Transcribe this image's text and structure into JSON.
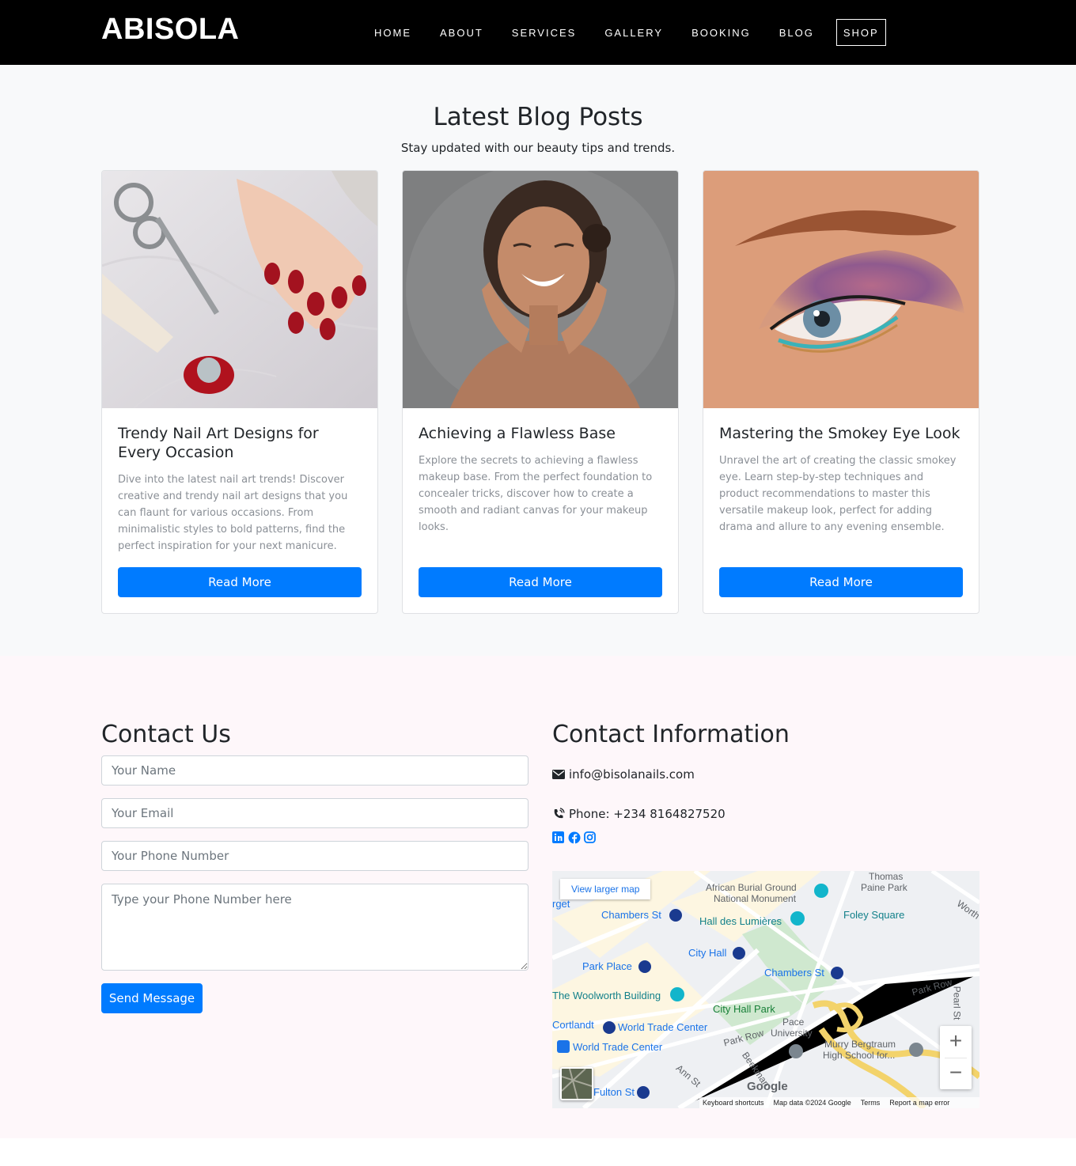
{
  "nav": {
    "brand": "ABISOLA",
    "links": [
      "HOME",
      "ABOUT",
      "SERVICES",
      "GALLERY",
      "BOOKING",
      "BLOG"
    ],
    "shop": "SHOP"
  },
  "blog": {
    "title": "Latest Blog Posts",
    "subtitle": "Stay updated with our beauty tips and trends.",
    "posts": [
      {
        "title": "Trendy Nail Art Designs for Every Occasion",
        "text": "Dive into the latest nail art trends! Discover creative and trendy nail art designs that you can flaunt for various occasions. From minimalistic styles to bold patterns, find the perfect inspiration for your next manicure.",
        "button": "Read More"
      },
      {
        "title": "Achieving a Flawless Base",
        "text": "Explore the secrets to achieving a flawless makeup base. From the perfect foundation to concealer tricks, discover how to create a smooth and radiant canvas for your makeup looks.",
        "button": "Read More"
      },
      {
        "title": "Mastering the Smokey Eye Look",
        "text": "Unravel the art of creating the classic smokey eye. Learn step-by-step techniques and product recommendations to master this versatile makeup look, perfect for adding drama and allure to any evening ensemble.",
        "button": "Read More"
      }
    ]
  },
  "contact": {
    "title": "Contact Us",
    "name_placeholder": "Your Name",
    "email_placeholder": "Your Email",
    "phone_placeholder": "Your Phone Number",
    "message_placeholder": "Type your Phone Number here",
    "send": "Send Message"
  },
  "info": {
    "title": "Contact Information",
    "email": "info@bisolanails.com",
    "phone": "Phone: +234 8164827520",
    "socials": [
      "linkedin-icon",
      "facebook-icon",
      "instagram-icon"
    ]
  },
  "map": {
    "view_larger": "View larger map",
    "labels": [
      "African Burial Ground",
      "National Monument",
      "Thomas",
      "Paine Park",
      "Worth",
      "Chambers St",
      "Hall des Lumières",
      "Foley Square",
      "City Hall",
      "Park Place",
      "Chambers St",
      "Park Row",
      "The Woolworth Building",
      "City Hall Park",
      "Pearl St",
      "Cortlandt",
      "World Trade Center",
      "Pace",
      "University",
      "Park Row",
      "World Trade Center",
      "Murry Bergtraum",
      "High School for...",
      "Beekman",
      "Ann St",
      "Fulton St",
      "rget"
    ],
    "google": "Google",
    "footer": [
      "Keyboard shortcuts",
      "Map data ©2024 Google",
      "Terms",
      "Report a map error"
    ],
    "zoom_in": "+",
    "zoom_out": "−"
  },
  "colors": {
    "primary": "#007bff",
    "nav_bg": "#000000",
    "blog_bg": "#f8f9fa",
    "contact_bg": "#fef7fa"
  }
}
